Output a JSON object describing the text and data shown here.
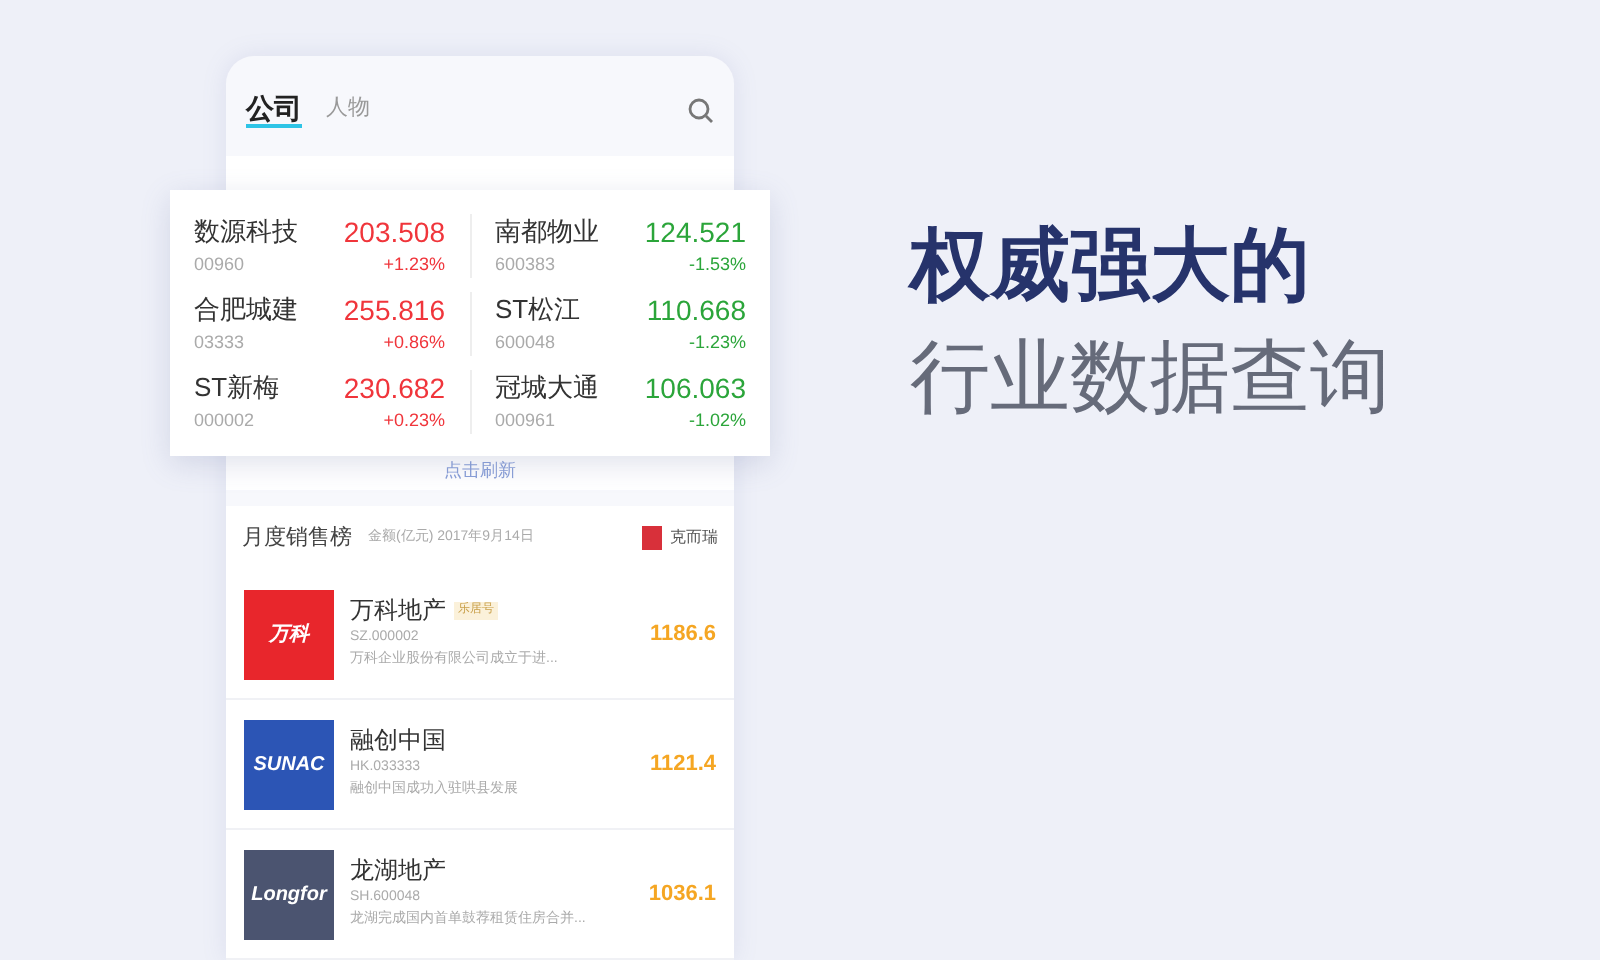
{
  "tabs": [
    {
      "label": "公司",
      "selected": true
    },
    {
      "label": "人物",
      "selected": false
    }
  ],
  "gainers": {
    "rows": [
      {
        "left": {
          "name": "数源科技",
          "code": "00960",
          "price": "203.508",
          "change": "+1.23%",
          "color": "#f0353b"
        },
        "right": {
          "name": "南都物业",
          "code": "600383",
          "price": "124.521",
          "change": "-1.53%",
          "color": "#2ba53a"
        }
      },
      {
        "left": {
          "name": "合肥城建",
          "code": "03333",
          "price": "255.816",
          "change": "+0.86%",
          "color": "#f0353b"
        },
        "right": {
          "name": "ST松江",
          "code": "600048",
          "price": "110.668",
          "change": "-1.23%",
          "color": "#2ba53a"
        }
      },
      {
        "left": {
          "name": "ST新梅",
          "code": "000002",
          "price": "230.682",
          "change": "+0.23%",
          "color": "#f0353b"
        },
        "right": {
          "name": "冠城大通",
          "code": "000961",
          "price": "106.063",
          "change": "-1.02%",
          "color": "#2ba53a"
        }
      }
    ],
    "refresh": "点击刷新"
  },
  "sales": {
    "title": "月度销售榜",
    "subtitle": "金额(亿元) 2017年9月14日",
    "source": "克而瑞",
    "rows": [
      {
        "name": "万科地产",
        "tag": "乐居号",
        "code": "SZ.000002",
        "desc": "万科企业股份有限公司成立于进...",
        "amount": "1186.6",
        "color": "#e8262c",
        "logo_text": "万科"
      },
      {
        "name": "融创中国",
        "code": "HK.033333",
        "desc": "融创中国成功入驻哄县发展",
        "amount": "1121.4",
        "color": "#2c55b5",
        "logo_text": "SUNAC"
      },
      {
        "name": "龙湖地产",
        "code": "SH.600048",
        "desc": "龙湖完成国内首单鼓荐租赁住房合并...",
        "amount": "1036.1",
        "color": "#4b5470",
        "logo_text": "Longfor"
      }
    ]
  },
  "headline": {
    "line1": "权威强大的",
    "line2": "行业数据查询"
  }
}
